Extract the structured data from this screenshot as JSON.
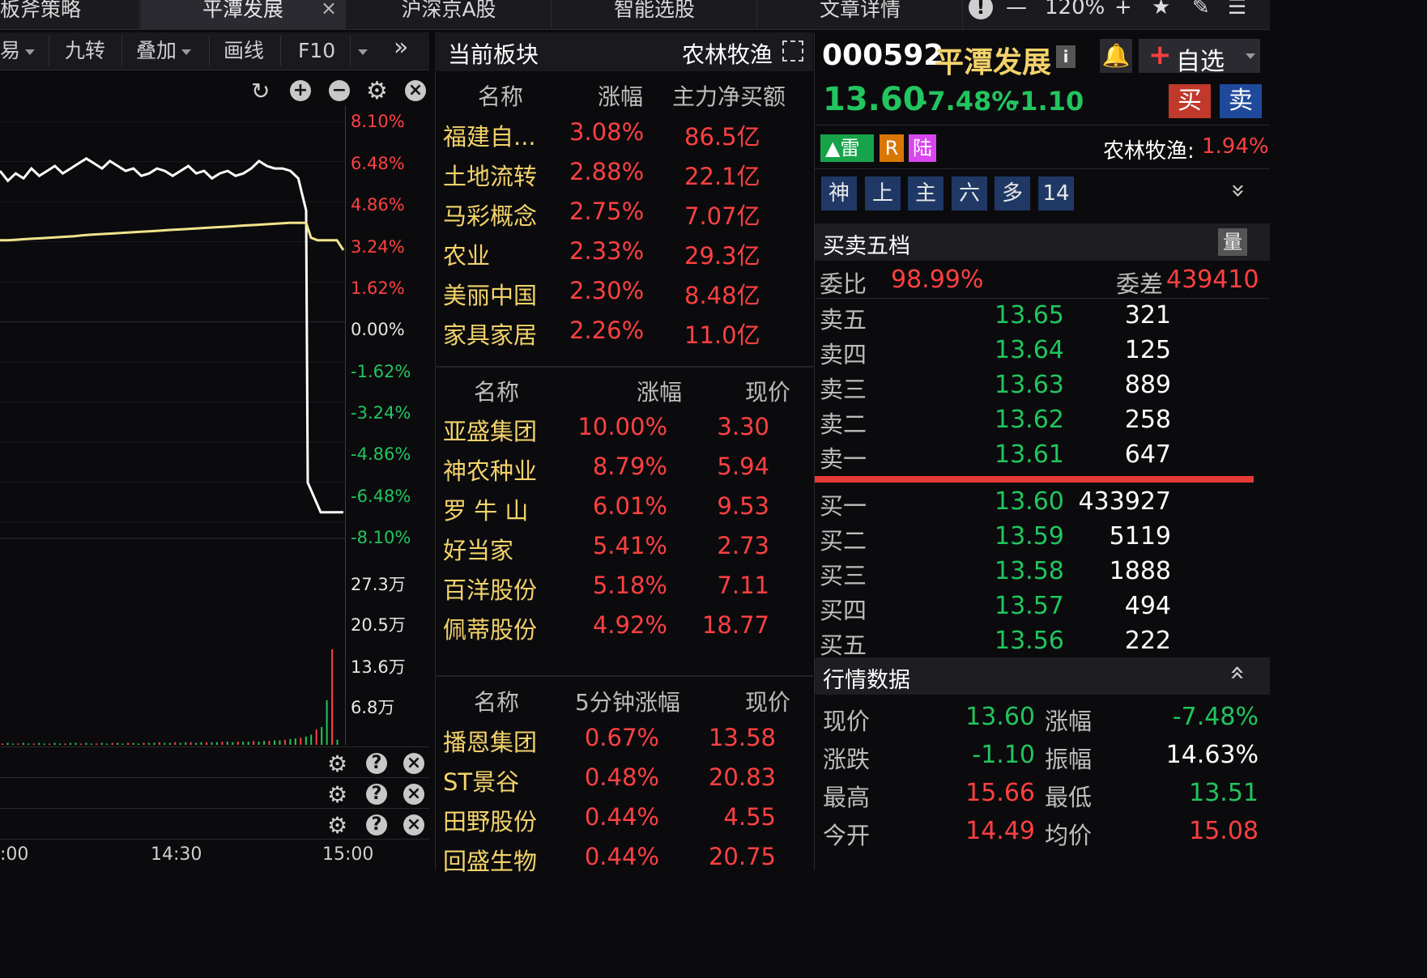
{
  "top_tabs": [
    {
      "label": "板斧策略"
    },
    {
      "label": "平潭发展",
      "close": "×"
    },
    {
      "label": "沪深京A股"
    },
    {
      "label": "智能选股"
    },
    {
      "label": "文章详情"
    }
  ],
  "top_controls": {
    "zoom": "120%"
  },
  "chart_toolbar": [
    "易",
    "九转",
    "叠加",
    "画线",
    "F10"
  ],
  "chart_data": {
    "type": "line",
    "y_pct_ticks": [
      "8.10%",
      "6.48%",
      "4.86%",
      "3.24%",
      "1.62%",
      "0.00%",
      "-1.62%",
      "-3.24%",
      "-4.86%",
      "-6.48%",
      "-8.10%"
    ],
    "vol_ticks": [
      "27.3万",
      "20.5万",
      "13.6万",
      "6.8万"
    ],
    "x_ticks": [
      ":00",
      "14:30",
      "15:00"
    ],
    "series": [
      {
        "color": "#ffffff",
        "values": [
          6.1,
          5.7,
          6.0,
          5.8,
          6.2,
          5.9,
          6.1,
          6.3,
          6.0,
          6.2,
          6.4,
          6.6,
          6.4,
          6.2,
          6.5,
          6.3,
          6.1,
          6.2,
          5.9,
          6.0,
          6.2,
          6.1,
          5.9,
          6.1,
          6.3,
          6.0,
          6.1,
          5.8,
          6.0,
          6.1,
          5.9,
          6.0,
          6.2,
          6.5,
          6.3,
          6.2,
          6.2,
          6.1,
          5.8,
          4.5,
          -6.5,
          -7.7,
          -7.7,
          -7.7
        ]
      },
      {
        "color": "#f3e38a",
        "values": [
          3.3,
          3.3,
          3.32,
          3.34,
          3.36,
          3.38,
          3.4,
          3.42,
          3.44,
          3.46,
          3.5,
          3.52,
          3.54,
          3.56,
          3.58,
          3.6,
          3.62,
          3.64,
          3.66,
          3.68,
          3.7,
          3.72,
          3.74,
          3.76,
          3.78,
          3.8,
          3.82,
          3.84,
          3.86,
          3.88,
          3.9,
          3.92,
          3.94,
          3.96,
          3.98,
          4.0,
          4.0,
          4.0,
          3.4,
          3.3,
          3.3,
          3.3,
          2.9
        ]
      }
    ],
    "volume": [
      2,
      3,
      2,
      2,
      3,
      2,
      2,
      3,
      2,
      2,
      3,
      2,
      2,
      3,
      3,
      2,
      3,
      2,
      2,
      3,
      2,
      3,
      3,
      2,
      3,
      3,
      2,
      3,
      3,
      3,
      4,
      3,
      3,
      4,
      3,
      4,
      4,
      3,
      4,
      4,
      4,
      4,
      5,
      5,
      4,
      5,
      5,
      5,
      6,
      5,
      6,
      6,
      7,
      7,
      8,
      9,
      10,
      11,
      13,
      16,
      24,
      28,
      70,
      150,
      8
    ]
  },
  "current_sector": {
    "title": "当前板块",
    "sector": "农林牧渔"
  },
  "sector_table": {
    "headers": [
      "名称",
      "涨幅",
      "主力净买额"
    ],
    "rows": [
      {
        "name": "福建自...",
        "change": "3.08%",
        "amount": "86.5亿"
      },
      {
        "name": "土地流转",
        "change": "2.88%",
        "amount": "22.1亿"
      },
      {
        "name": "马彩概念",
        "change": "2.75%",
        "amount": "7.07亿"
      },
      {
        "name": "农业",
        "change": "2.33%",
        "amount": "29.3亿"
      },
      {
        "name": "美丽中国",
        "change": "2.30%",
        "amount": "8.48亿"
      },
      {
        "name": "家具家居",
        "change": "2.26%",
        "amount": "11.0亿"
      }
    ]
  },
  "stock_table": {
    "headers": [
      "名称",
      "涨幅",
      "现价"
    ],
    "rows": [
      {
        "name": "亚盛集团",
        "change": "10.00%",
        "price": "3.30"
      },
      {
        "name": "神农种业",
        "change": "8.79%",
        "price": "5.94"
      },
      {
        "name": "罗 牛 山",
        "change": "6.01%",
        "price": "9.53"
      },
      {
        "name": "好当家",
        "change": "5.41%",
        "price": "2.73"
      },
      {
        "name": "百洋股份",
        "change": "5.18%",
        "price": "7.11"
      },
      {
        "name": "佩蒂股份",
        "change": "4.92%",
        "price": "18.77"
      }
    ]
  },
  "fivemin_table": {
    "headers": [
      "名称",
      "5分钟涨幅",
      "现价"
    ],
    "rows": [
      {
        "name": "播恩集团",
        "change": "0.67%",
        "price": "13.58"
      },
      {
        "name": "ST景谷",
        "change": "0.48%",
        "price": "20.83"
      },
      {
        "name": "田野股份",
        "change": "0.44%",
        "price": "4.55"
      },
      {
        "name": "回盛生物",
        "change": "0.44%",
        "price": "20.75"
      }
    ]
  },
  "stock": {
    "code": "000592",
    "name": "平潭发展",
    "price": "13.60",
    "change_pct": "-7.48%",
    "change": "-1.10",
    "watch_label": "自选",
    "buy_label": "买",
    "sell_label": "卖",
    "tags": [
      "雷",
      "R",
      "陆"
    ],
    "sector_label": "农林牧渔:",
    "sector_change": "1.94%",
    "quick_tags": [
      "神",
      "上",
      "主",
      "六",
      "多",
      "14"
    ]
  },
  "orderbook": {
    "title": "买卖五档",
    "volume_btn": "量",
    "ratio_label": "委比",
    "ratio": "98.99%",
    "diff_label": "委差",
    "diff": "439410",
    "asks": [
      {
        "label": "卖五",
        "price": "13.65",
        "vol": "321"
      },
      {
        "label": "卖四",
        "price": "13.64",
        "vol": "125"
      },
      {
        "label": "卖三",
        "price": "13.63",
        "vol": "889"
      },
      {
        "label": "卖二",
        "price": "13.62",
        "vol": "258"
      },
      {
        "label": "卖一",
        "price": "13.61",
        "vol": "647"
      }
    ],
    "bids": [
      {
        "label": "买一",
        "price": "13.60",
        "vol": "433927"
      },
      {
        "label": "买二",
        "price": "13.59",
        "vol": "5119"
      },
      {
        "label": "买三",
        "price": "13.58",
        "vol": "1888"
      },
      {
        "label": "买四",
        "price": "13.57",
        "vol": "494"
      },
      {
        "label": "买五",
        "price": "13.56",
        "vol": "222"
      }
    ]
  },
  "quote": {
    "title": "行情数据",
    "rows": [
      {
        "l1": "现价",
        "v1": "13.60",
        "l2": "涨幅",
        "v2": "-7.48%"
      },
      {
        "l1": "涨跌",
        "v1": "-1.10",
        "l2": "振幅",
        "v2": "14.63%"
      },
      {
        "l1": "最高",
        "v1": "15.66",
        "l2": "最低",
        "v2": "13.51"
      },
      {
        "l1": "今开",
        "v1": "14.49",
        "l2": "均价",
        "v2": "15.08"
      }
    ]
  }
}
